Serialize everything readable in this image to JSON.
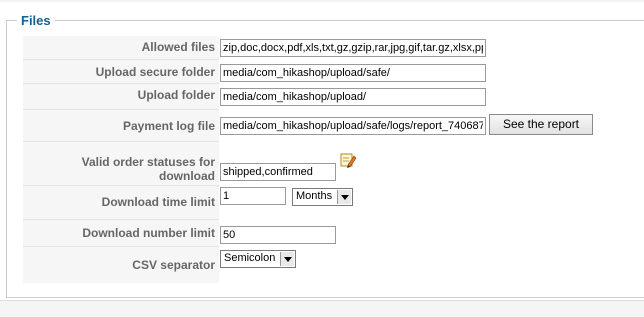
{
  "fieldset": {
    "legend": "Files"
  },
  "rows": {
    "allowed_files": {
      "label": "Allowed files",
      "value": "zip,doc,docx,pdf,xls,txt,gz,gzip,rar,jpg,gif,tar.gz,xlsx,pps,c"
    },
    "upload_secure_folder": {
      "label": "Upload secure folder",
      "value": "media/com_hikashop/upload/safe/"
    },
    "upload_folder": {
      "label": "Upload folder",
      "value": "media/com_hikashop/upload/"
    },
    "payment_log_file": {
      "label": "Payment log file",
      "value": "media/com_hikashop/upload/safe/logs/report_740687",
      "button": "See the report"
    },
    "valid_order_statuses": {
      "label": "Valid order statuses for download",
      "value": "shipped,confirmed",
      "icon": "edit-icon"
    },
    "download_time_limit": {
      "label": "Download time limit",
      "value": "1",
      "unit": "Months"
    },
    "download_number_limit": {
      "label": "Download number limit",
      "value": "50"
    },
    "csv_separator": {
      "label": "CSV separator",
      "value": "Semicolon"
    }
  }
}
